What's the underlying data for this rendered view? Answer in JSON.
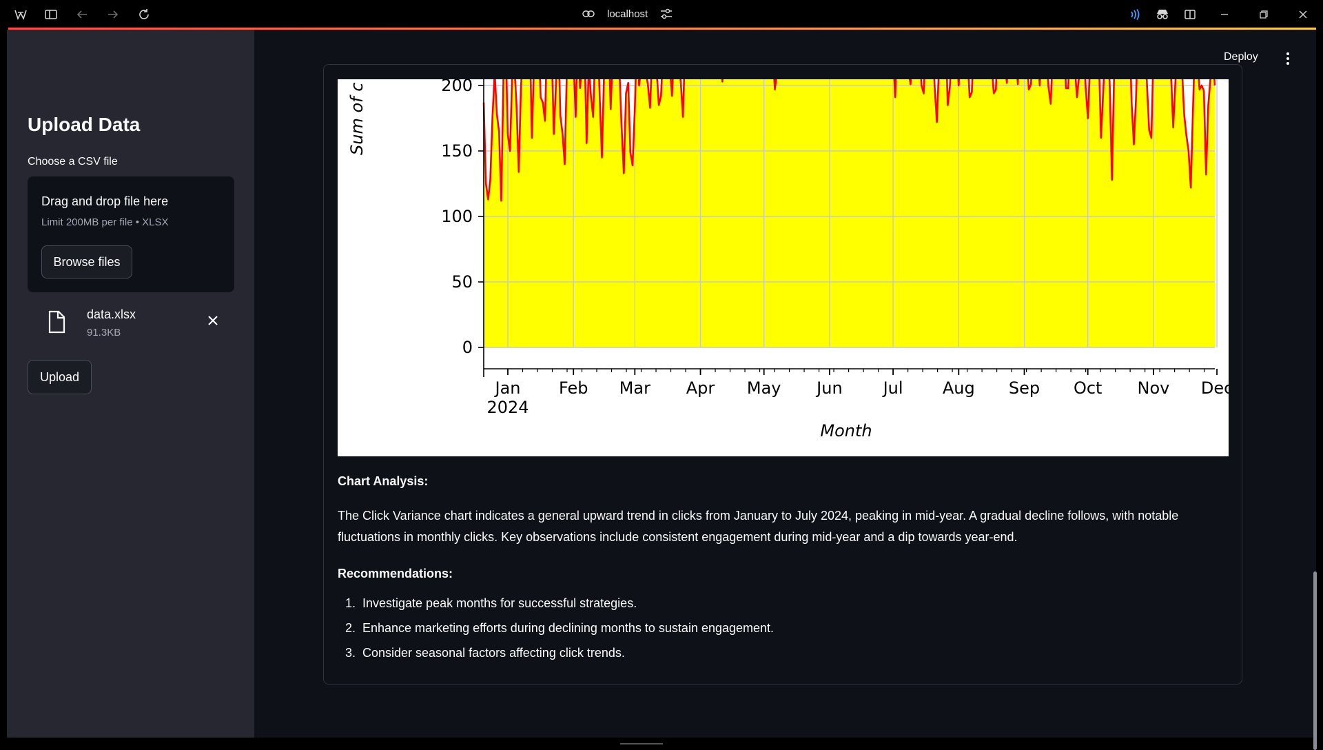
{
  "browser": {
    "url": "localhost"
  },
  "sidebar": {
    "title": "Upload Data",
    "file_label": "Choose a CSV file",
    "dropzone": {
      "title": "Drag and drop file here",
      "limit": "Limit 200MB per file • XLSX",
      "browse_label": "Browse files"
    },
    "file": {
      "name": "data.xlsx",
      "size": "91.3KB"
    },
    "upload_label": "Upload"
  },
  "header": {
    "deploy_label": "Deploy"
  },
  "chart_data": {
    "type": "area",
    "title": "",
    "xlabel": "Month",
    "ylabel": "Sum of c",
    "x_ticks": [
      "Jan",
      "Feb",
      "Mar",
      "Apr",
      "May",
      "Jun",
      "Jul",
      "Aug",
      "Sep",
      "Oct",
      "Nov",
      "Dec"
    ],
    "x_year_label": "2024",
    "y_ticks": [
      0,
      50,
      100,
      150,
      200
    ],
    "ylim_visible": [
      -20,
      207
    ],
    "fill_color": "#ffff00",
    "line_color": "#ff0000",
    "grid": true,
    "series": [
      {
        "values": [
          187,
          125,
          113,
          128,
          176,
          210,
          178,
          165,
          112,
          205,
          232,
          163,
          150,
          208,
          215,
          185,
          134,
          198,
          230,
          241,
          226,
          240,
          160,
          219,
          235,
          240,
          191,
          187,
          173,
          241,
          215,
          231,
          163,
          200,
          245,
          177,
          163,
          140,
          213,
          233,
          218,
          223,
          176,
          240,
          198,
          216,
          235,
          156,
          216,
          191,
          176,
          231,
          243,
          190,
          145,
          211,
          228,
          242,
          182,
          225,
          220,
          247,
          211,
          168,
          133,
          194,
          202,
          149,
          139,
          181,
          238,
          200,
          215,
          242,
          210,
          201,
          183,
          226,
          241,
          211,
          185,
          192,
          231,
          239,
          250,
          215,
          192,
          228,
          240,
          221,
          203,
          176,
          232,
          246,
          210,
          248,
          226,
          227,
          214,
          232,
          241,
          228,
          230,
          215,
          244,
          228,
          218,
          245,
          241,
          203,
          225,
          239,
          235,
          252,
          238,
          219,
          240,
          236,
          243,
          212,
          228,
          238,
          246,
          229,
          221,
          235,
          252,
          208,
          231,
          229,
          245,
          216,
          227,
          197,
          210,
          236,
          244,
          221,
          242,
          237,
          227,
          207,
          232,
          247,
          241,
          214,
          236,
          220,
          241,
          248,
          240,
          227,
          232,
          241,
          245,
          237,
          228,
          243,
          222,
          248,
          227,
          232,
          238,
          246,
          234,
          215,
          238,
          244,
          250,
          232,
          229,
          241,
          226,
          242,
          248,
          235,
          226,
          243,
          218,
          236,
          244,
          230,
          242,
          215,
          240,
          232,
          245,
          226,
          191,
          247,
          236,
          242,
          223,
          240,
          212,
          201,
          232,
          243,
          220,
          238,
          200,
          194,
          233,
          245,
          220,
          236,
          199,
          172,
          214,
          244,
          226,
          239,
          185,
          200,
          235,
          215,
          228,
          200,
          242,
          210,
          232,
          223,
          191,
          195,
          240,
          233,
          247,
          215,
          231,
          231,
          243,
          238,
          217,
          194,
          197,
          244,
          232,
          238,
          218,
          202,
          245,
          231,
          237,
          227,
          201,
          243,
          236,
          240,
          225,
          197,
          201,
          238,
          249,
          227,
          200,
          243,
          240,
          226,
          199,
          186,
          225,
          244,
          231,
          210,
          237,
          242,
          198,
          198,
          241,
          234,
          215,
          191,
          207,
          243,
          236,
          198,
          175,
          215,
          242,
          234,
          215,
          225,
          160,
          195,
          232,
          238,
          200,
          128,
          210,
          245,
          222,
          236,
          212,
          207,
          236,
          244,
          186,
          155,
          190,
          244,
          213,
          225,
          239,
          201,
          166,
          160,
          228,
          240,
          236,
          217,
          208,
          222,
          238,
          232,
          208,
          168,
          203,
          234,
          232,
          212,
          178,
          162,
          150,
          122,
          180,
          238,
          224,
          197,
          200,
          196,
          132,
          185,
          205,
          226,
          200
        ]
      }
    ],
    "analysis": {
      "title": "Chart Analysis:",
      "text": "The Click Variance chart indicates a general upward trend in clicks from January to July 2024, peaking in mid-year. A gradual decline follows, with notable fluctuations in monthly clicks. Key observations include consistent engagement during mid-year and a dip towards year-end."
    },
    "recommendations": {
      "title": "Recommendations:",
      "items": [
        {
          "num": "1.",
          "text": "Investigate peak months for successful strategies."
        },
        {
          "num": "2.",
          "text": "Enhance marketing efforts during declining months to sustain engagement."
        },
        {
          "num": "3.",
          "text": "Consider seasonal factors affecting click trends."
        }
      ]
    }
  },
  "colors": {
    "sidebar_bg": "#262730",
    "main_bg": "#0e1117",
    "accent_start": "#ff4b4b",
    "accent_end": "#ffd23a"
  }
}
